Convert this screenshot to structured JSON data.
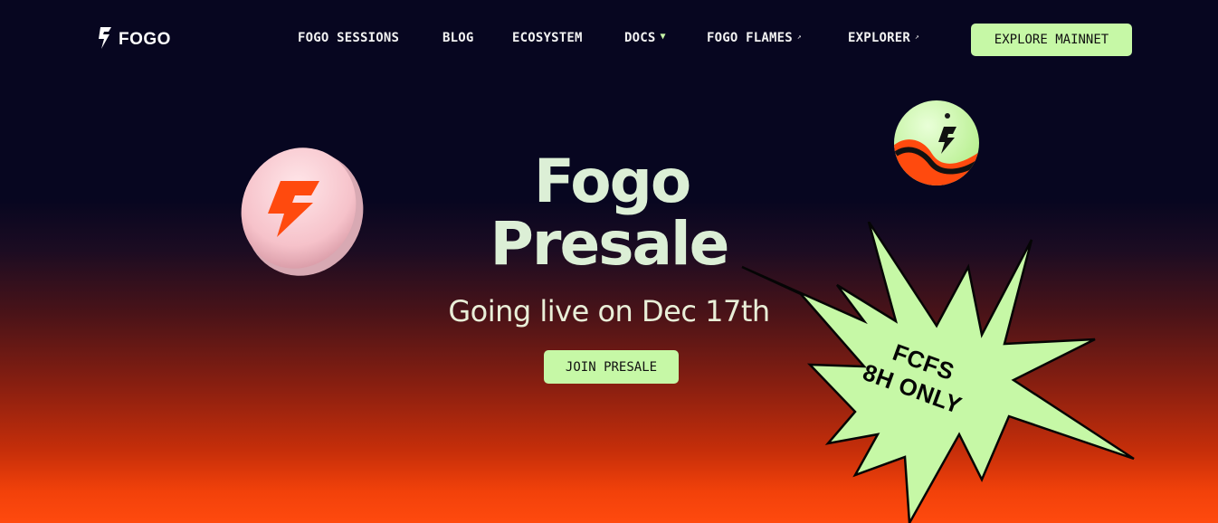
{
  "brand": {
    "name": "FOGO",
    "icon": "fogo-bolt-icon"
  },
  "nav": {
    "items": [
      {
        "label": "FOGO SESSIONS",
        "external": false,
        "dropdown": false
      },
      {
        "label": "BLOG",
        "external": false,
        "dropdown": false
      },
      {
        "label": "ECOSYSTEM",
        "external": false,
        "dropdown": false
      },
      {
        "label": "DOCS",
        "external": false,
        "dropdown": true
      },
      {
        "label": "FOGO FLAMES",
        "external": true,
        "dropdown": false
      },
      {
        "label": "EXPLORER",
        "external": true,
        "dropdown": false
      }
    ],
    "external_glyph": "↗",
    "dropdown_glyph": "▼",
    "cta_label": "EXPLORE MAINNET"
  },
  "hero": {
    "title_line1": "Fogo",
    "title_line2": "Presale",
    "subtitle": "Going live on Dec 17th",
    "cta_label": "JOIN PRESALE"
  },
  "badge": {
    "line1": "FCFS",
    "line2": "8H ONLY"
  },
  "colors": {
    "accent": "#c6f8a6",
    "background_top": "#070620",
    "background_bottom": "#ff4a0e",
    "brand_orange": "#ff4a0e"
  }
}
